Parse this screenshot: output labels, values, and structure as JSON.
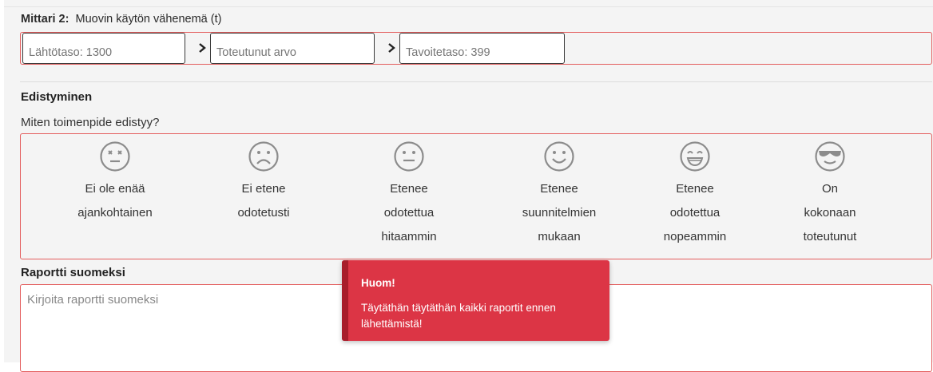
{
  "metric": {
    "label_bold": "Mittari 2:",
    "label_text": "Muovin käytön vähenemä (t)",
    "baseline_placeholder": "Lähtötaso: 1300",
    "actual_placeholder": "Toteutunut arvo",
    "target_placeholder": "Tavoitetaso: 399"
  },
  "progress": {
    "title": "Edistyminen",
    "question": "Miten toimenpide edistyy?",
    "options": [
      {
        "lines": [
          "Ei ole enää",
          "ajankohtainen"
        ],
        "icon": "dizzy-face-icon"
      },
      {
        "lines": [
          "Ei etene",
          "odotetusti"
        ],
        "icon": "sad-face-icon"
      },
      {
        "lines": [
          "Etenee",
          "odotettua",
          "hitaammin"
        ],
        "icon": "neutral-face-icon"
      },
      {
        "lines": [
          "Etenee",
          "suunnitelmien",
          "mukaan"
        ],
        "icon": "smile-face-icon"
      },
      {
        "lines": [
          "Etenee",
          "odotettua",
          "nopeammin"
        ],
        "icon": "grin-face-icon"
      },
      {
        "lines": [
          "On",
          "kokonaan",
          "toteutunut"
        ],
        "icon": "sunglasses-face-icon"
      }
    ]
  },
  "report": {
    "title": "Raportti suomeksi",
    "placeholder": "Kirjoita raportti suomeksi"
  },
  "toast": {
    "title": "Huom!",
    "message": "Täytäthän täytäthän kaikki raportit ennen lähettämistä!"
  },
  "colors": {
    "error_border": "#e35d5d",
    "toast_bg": "#dc3545",
    "icon_gray": "#8c8c8c"
  }
}
